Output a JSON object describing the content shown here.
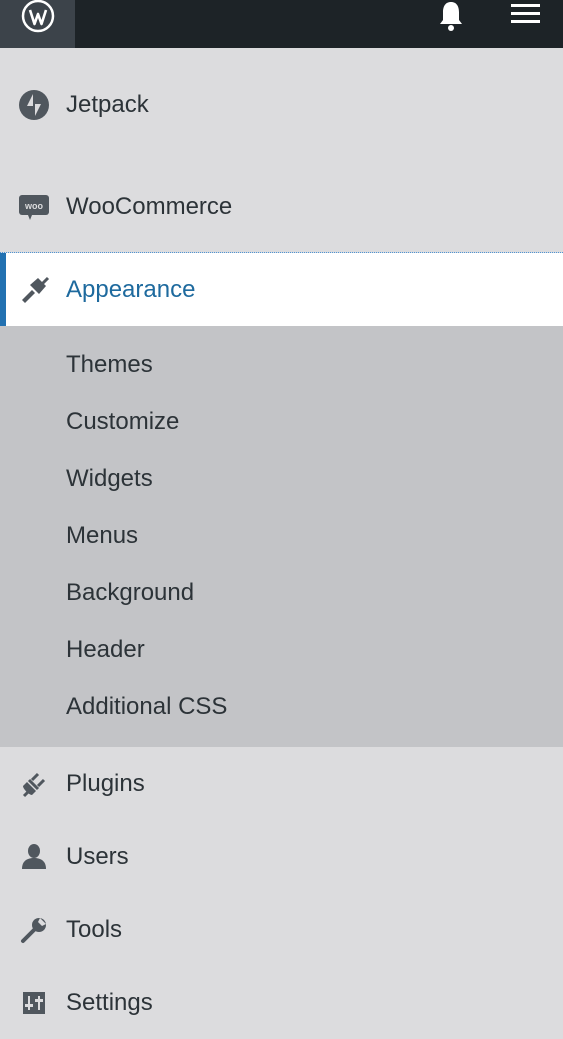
{
  "topbar": {
    "logo_icon": "wordpress-logo-icon",
    "notifications_icon": "bell-icon",
    "menu_icon": "hamburger-icon"
  },
  "menu": {
    "jetpack": "Jetpack",
    "woocommerce": "WooCommerce",
    "appearance": "Appearance",
    "submenu": [
      "Themes",
      "Customize",
      "Widgets",
      "Menus",
      "Background",
      "Header",
      "Additional CSS"
    ],
    "plugins": "Plugins",
    "users": "Users",
    "tools": "Tools",
    "settings": "Settings"
  },
  "colors": {
    "topbar": "#1d2327",
    "active_accent": "#2271b1",
    "active_text": "#1e6a9e",
    "submenu_bg": "#c3c4c7",
    "menu_bg": "#dcdcde"
  }
}
